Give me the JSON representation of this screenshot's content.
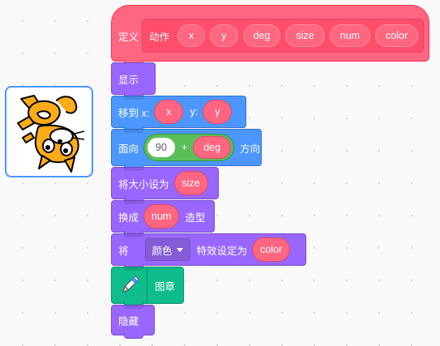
{
  "colors": {
    "define": "#ff6680",
    "motion": "#4c97ff",
    "looks": "#9966ff",
    "pen": "#0fbd8c",
    "operators": "#59c059"
  },
  "sprite": {
    "icon": "cat-sprite-upside-down"
  },
  "define_block": {
    "keyword": "定义",
    "name": "动作",
    "params": [
      "x",
      "y",
      "deg",
      "size",
      "num",
      "color"
    ]
  },
  "show_block": {
    "label": "显示"
  },
  "goto_block": {
    "label_x": "移到 x:",
    "arg_x": "x",
    "label_y": "y:",
    "arg_y": "y"
  },
  "point_block": {
    "label": "面向",
    "num": "90",
    "op": "+",
    "arg": "deg",
    "suffix": "方向"
  },
  "size_block": {
    "label": "将大小设为",
    "arg": "size"
  },
  "costume_block": {
    "label": "换成",
    "arg": "num",
    "suffix": "造型"
  },
  "effect_block": {
    "label": "将",
    "dropdown": "颜色",
    "middle": "特效设定为",
    "arg": "color"
  },
  "stamp_block": {
    "icon": "pen-icon",
    "label": "图章"
  },
  "hide_block": {
    "label": "隐藏"
  }
}
